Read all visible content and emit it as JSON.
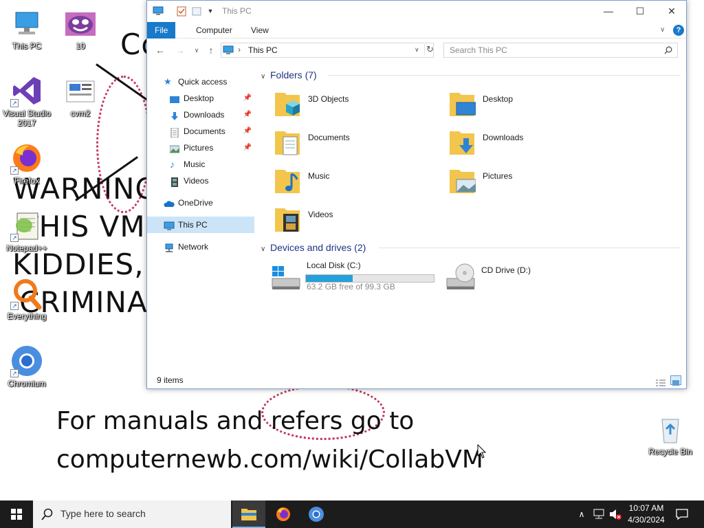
{
  "wallpaper": {
    "line_co": "Co",
    "line_warning": "WARNING",
    "line_vm": "THIS VM I",
    "line_kiddies": "KIDDIES,",
    "line_criminal": "CRIMINAL",
    "footer_1": "For  manuals and refers go to",
    "footer_2": "computernewb.com/wiki/CollabVM"
  },
  "desktop_icons": [
    {
      "label": "This PC",
      "icon": "this-pc-icon"
    },
    {
      "label": "10",
      "icon": "smiley-image-icon"
    },
    {
      "label": "Visual Studio 2017",
      "icon": "visual-studio-icon"
    },
    {
      "label": "cvm2",
      "icon": "cvm-image-icon"
    },
    {
      "label": "Firefox",
      "icon": "firefox-icon"
    },
    {
      "label": "Notepad++",
      "icon": "notepadpp-icon"
    },
    {
      "label": "Everything",
      "icon": "everything-search-icon"
    },
    {
      "label": "Chromium",
      "icon": "chromium-icon"
    },
    {
      "label": "Recycle Bin",
      "icon": "recycle-bin-icon"
    }
  ],
  "explorer": {
    "title": "This PC",
    "ribbon_tabs": [
      "File",
      "Computer",
      "View"
    ],
    "help": "?",
    "address": {
      "separator": "›",
      "location": "This PC"
    },
    "search_placeholder": "Search This PC",
    "sidebar": [
      {
        "label": "Quick access",
        "icon": "star-icon"
      },
      {
        "label": "Desktop",
        "icon": "desktop-folder-icon",
        "pinned": true
      },
      {
        "label": "Downloads",
        "icon": "downloads-arrow-icon",
        "pinned": true
      },
      {
        "label": "Documents",
        "icon": "documents-icon",
        "pinned": true
      },
      {
        "label": "Pictures",
        "icon": "pictures-icon",
        "pinned": true
      },
      {
        "label": "Music",
        "icon": "music-note-icon"
      },
      {
        "label": "Videos",
        "icon": "videos-film-icon"
      },
      {
        "label": "OneDrive",
        "icon": "onedrive-cloud-icon"
      },
      {
        "label": "This PC",
        "icon": "this-pc-icon",
        "selected": true
      },
      {
        "label": "Network",
        "icon": "network-icon"
      }
    ],
    "groups": {
      "folders_title": "Folders (7)",
      "devices_title": "Devices and drives (2)"
    },
    "folders": [
      {
        "name": "3D Objects",
        "icon": "3d-objects-icon"
      },
      {
        "name": "Desktop",
        "icon": "desktop-folder-icon"
      },
      {
        "name": "Documents",
        "icon": "documents-icon"
      },
      {
        "name": "Downloads",
        "icon": "downloads-arrow-icon"
      },
      {
        "name": "Music",
        "icon": "music-note-icon"
      },
      {
        "name": "Pictures",
        "icon": "pictures-icon"
      },
      {
        "name": "Videos",
        "icon": "videos-film-icon"
      }
    ],
    "drives": [
      {
        "name": "Local Disk (C:)",
        "free_text": "63.2 GB free of 99.3 GB",
        "used_fraction": 0.364,
        "icon": "windows-drive-icon"
      },
      {
        "name": "CD Drive (D:)",
        "icon": "cd-drive-icon"
      }
    ],
    "status": "9 items"
  },
  "taskbar": {
    "search_placeholder": "Type here to search",
    "time": "10:07 AM",
    "date": "4/30/2024",
    "apps": [
      "file-explorer-icon",
      "firefox-icon",
      "chromium-icon"
    ]
  },
  "colors": {
    "accent": "#1979ca",
    "folder": "#f2c54c",
    "taskbar": "#1c1c1c",
    "drive_bar": "#26a0da"
  }
}
